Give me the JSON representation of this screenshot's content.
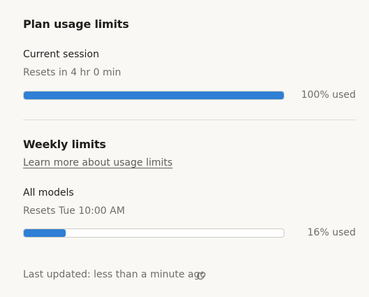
{
  "plan": {
    "title": "Plan usage limits",
    "current_session": {
      "label": "Current session",
      "resets": "Resets in 4 hr 0 min",
      "used_text": "100% used",
      "used_fraction": 1.0
    }
  },
  "weekly": {
    "title": "Weekly limits",
    "learn_more": "Learn more about usage limits",
    "all_models": {
      "label": "All models",
      "resets": "Resets Tue 10:00 AM",
      "used_text": "16% used",
      "used_fraction": 0.16
    }
  },
  "footer": {
    "last_updated": "Last updated: less than a minute ago",
    "refresh_icon": "refresh-icon"
  },
  "colors": {
    "bar_fill": "#2f7fd6",
    "background": "#f9f8f5"
  }
}
